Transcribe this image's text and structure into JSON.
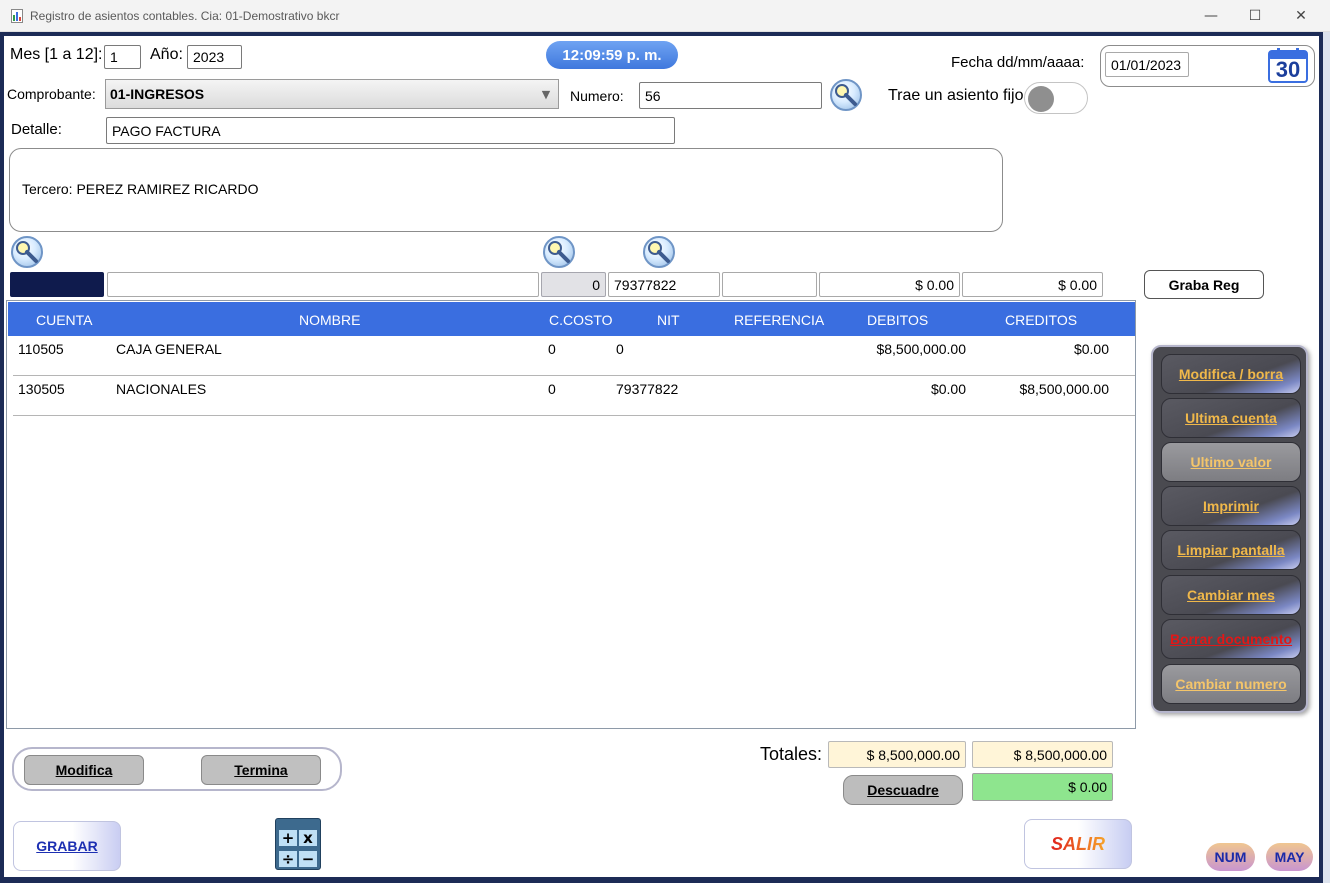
{
  "window": {
    "title": "Registro de asientos contables.  Cia: 01-Demostrativo bkcr",
    "minimize_glyph": "—",
    "maximize_glyph": "☐",
    "close_glyph": "✕"
  },
  "header": {
    "mes_label": "Mes [1 a 12]:",
    "mes_value": "1",
    "ano_label": "Año:",
    "ano_value": "2023",
    "clock": "12:09:59 p. m.",
    "fecha_label": "Fecha dd/mm/aaaa:",
    "fecha_value": "01/01/2023",
    "calendar_day": "30",
    "comprobante_label": "Comprobante:",
    "comprobante_value": "01-INGRESOS",
    "numero_label": "Numero:",
    "numero_value": "56",
    "asiento_fijo_label": "Trae un asiento fijo",
    "detalle_label": "Detalle:",
    "detalle_value": "PAGO FACTURA",
    "tercero_text": "Tercero:  PEREZ RAMIREZ RICARDO"
  },
  "entry": {
    "cuenta": "",
    "nombre": "",
    "ccosto": "0",
    "nit": "79377822",
    "referencia": "",
    "debitos": "$ 0.00",
    "creditos": "$ 0.00",
    "graba_reg_label": "Graba Reg"
  },
  "grid": {
    "headers": [
      "CUENTA",
      "NOMBRE",
      "C.COSTO",
      "NIT",
      "REFERENCIA",
      "DEBITOS",
      "CREDITOS"
    ],
    "rows": [
      {
        "cuenta": "110505",
        "nombre": "CAJA GENERAL",
        "ccosto": "0",
        "nit": "0",
        "referencia": "",
        "debitos": "$8,500,000.00",
        "creditos": "$0.00"
      },
      {
        "cuenta": "130505",
        "nombre": "NACIONALES",
        "ccosto": "0",
        "nit": "79377822",
        "referencia": "",
        "debitos": "$0.00",
        "creditos": "$8,500,000.00"
      }
    ]
  },
  "side_panel": {
    "buttons": [
      {
        "label": "Modifica / borra"
      },
      {
        "label": "Ultima cuenta"
      },
      {
        "label": "Ultimo valor"
      },
      {
        "label": "Imprimir"
      },
      {
        "label": "Limpiar pantalla"
      },
      {
        "label": "Cambiar mes"
      },
      {
        "label": "Borrar documento"
      },
      {
        "label": "Cambiar numero"
      }
    ]
  },
  "totals": {
    "label": "Totales:",
    "debitos": "$ 8,500,000.00",
    "creditos": "$ 8,500,000.00",
    "descuadre_label": "Descuadre",
    "descuadre_value": "$ 0.00"
  },
  "footer": {
    "modifica_label": "Modifica",
    "termina_label": "Termina",
    "grabar_label": "GRABAR",
    "salir_label": "SALIR",
    "calc_keys": [
      "+",
      "x",
      "÷",
      "−"
    ],
    "num_label": "NUM",
    "may_label": "MAY"
  },
  "colors": {
    "grid_header": "#3a6ee0",
    "clock": "#4f86e6",
    "descuadre_ok": "#8ee58e",
    "totals_bg": "#fff5d8",
    "panel_bg": "#4a4a50",
    "panel_text": "#f0b84a",
    "danger_text": "#e01818"
  }
}
